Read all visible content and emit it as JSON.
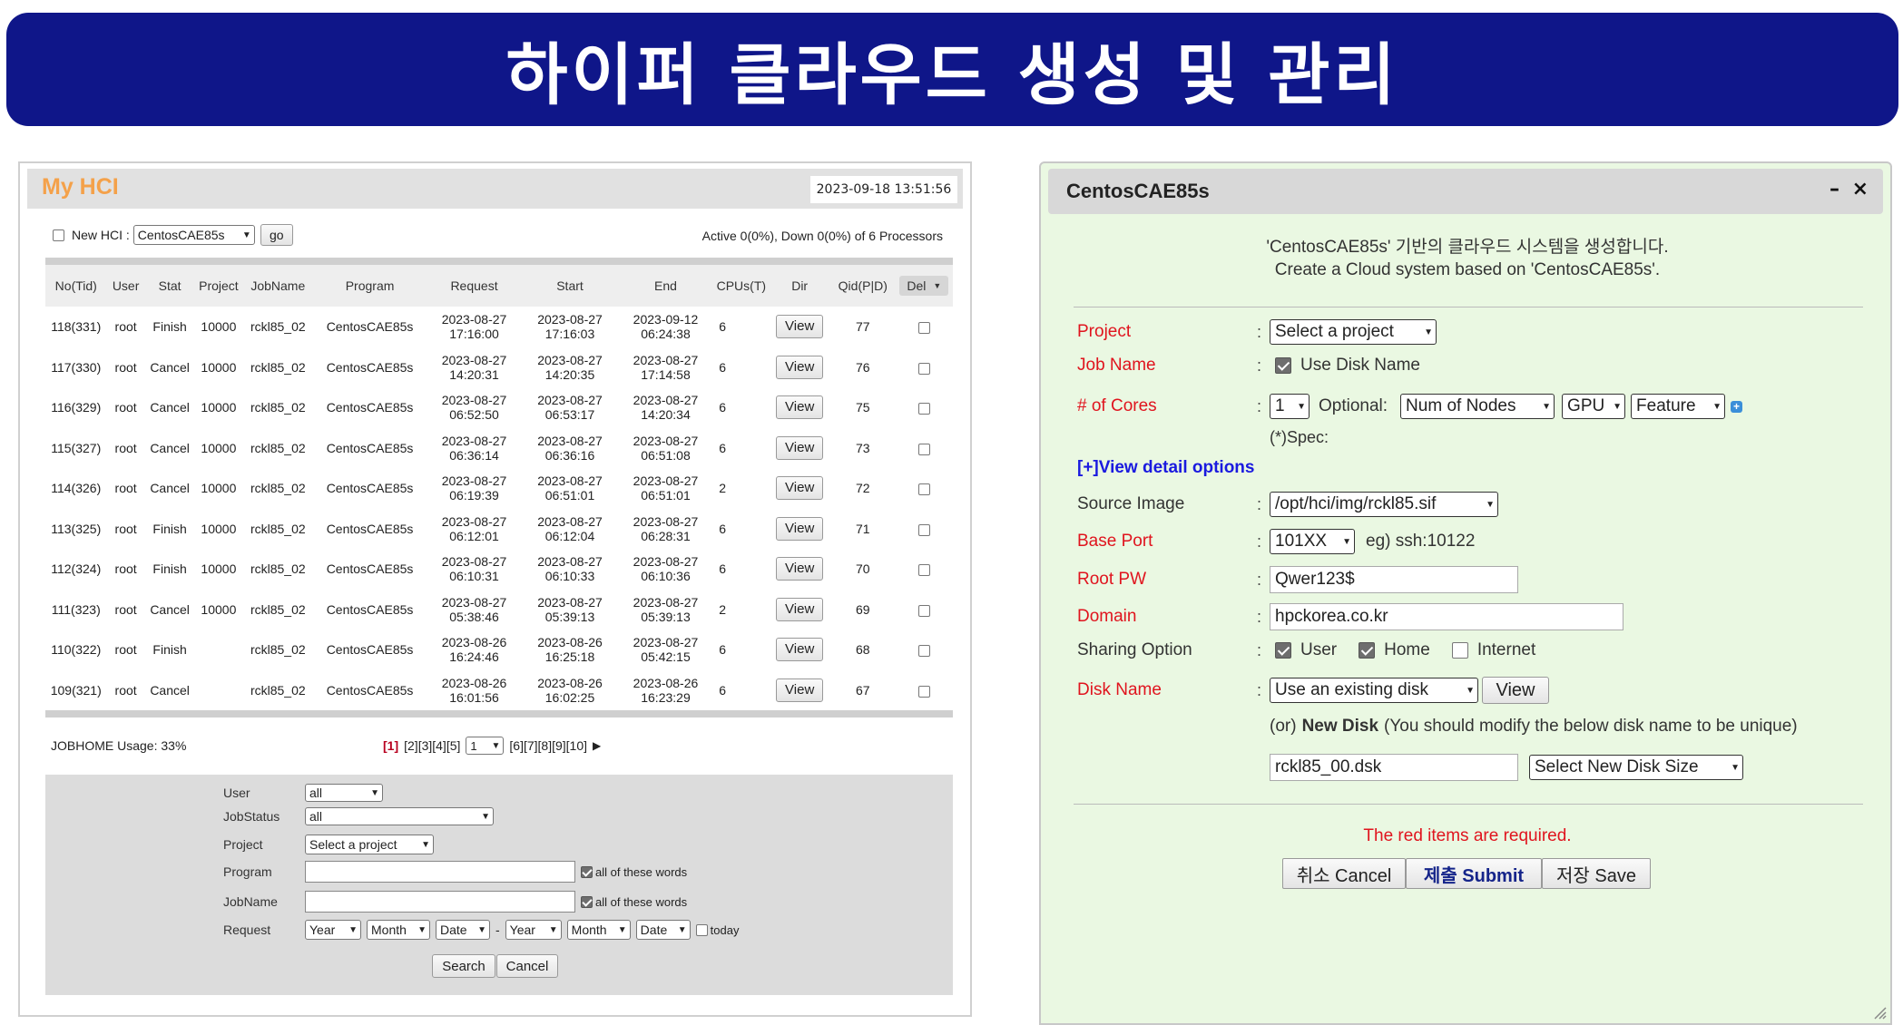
{
  "banner": {
    "title": "하이퍼 클라우드 생성 및 관리"
  },
  "my_hci": {
    "title": "My HCI",
    "datetime": "2023-09-18 13:51:56",
    "new_hci_label": "New HCI :",
    "new_hci_select": "CentosCAE85s",
    "go_label": "go",
    "processors_text": "Active 0(0%), Down 0(0%) of 6 Processors",
    "columns": [
      "No(Tid)",
      "User",
      "Stat",
      "Project",
      "JobName",
      "Program",
      "Request",
      "Start",
      "End",
      "CPUs(T)",
      "Dir",
      "Qid(P|D)",
      "Del"
    ],
    "view_label": "View",
    "rows": [
      {
        "no": "118(331)",
        "user": "root",
        "stat": "Finish",
        "project": "10000",
        "job": "rckl85_02",
        "program": "CentosCAE85s",
        "req_d": "2023-08-27",
        "req_t": "17:16:00",
        "start_d": "2023-08-27",
        "start_t": "17:16:03",
        "end_d": "2023-09-12",
        "end_t": "06:24:38",
        "cpus": "6",
        "qid": "77"
      },
      {
        "no": "117(330)",
        "user": "root",
        "stat": "Cancel",
        "project": "10000",
        "job": "rckl85_02",
        "program": "CentosCAE85s",
        "req_d": "2023-08-27",
        "req_t": "14:20:31",
        "start_d": "2023-08-27",
        "start_t": "14:20:35",
        "end_d": "2023-08-27",
        "end_t": "17:14:58",
        "cpus": "6",
        "qid": "76"
      },
      {
        "no": "116(329)",
        "user": "root",
        "stat": "Cancel",
        "project": "10000",
        "job": "rckl85_02",
        "program": "CentosCAE85s",
        "req_d": "2023-08-27",
        "req_t": "06:52:50",
        "start_d": "2023-08-27",
        "start_t": "06:53:17",
        "end_d": "2023-08-27",
        "end_t": "14:20:34",
        "cpus": "6",
        "qid": "75"
      },
      {
        "no": "115(327)",
        "user": "root",
        "stat": "Cancel",
        "project": "10000",
        "job": "rckl85_02",
        "program": "CentosCAE85s",
        "req_d": "2023-08-27",
        "req_t": "06:36:14",
        "start_d": "2023-08-27",
        "start_t": "06:36:16",
        "end_d": "2023-08-27",
        "end_t": "06:51:08",
        "cpus": "6",
        "qid": "73"
      },
      {
        "no": "114(326)",
        "user": "root",
        "stat": "Cancel",
        "project": "10000",
        "job": "rckl85_02",
        "program": "CentosCAE85s",
        "req_d": "2023-08-27",
        "req_t": "06:19:39",
        "start_d": "2023-08-27",
        "start_t": "06:51:01",
        "end_d": "2023-08-27",
        "end_t": "06:51:01",
        "cpus": "2",
        "qid": "72"
      },
      {
        "no": "113(325)",
        "user": "root",
        "stat": "Finish",
        "project": "10000",
        "job": "rckl85_02",
        "program": "CentosCAE85s",
        "req_d": "2023-08-27",
        "req_t": "06:12:01",
        "start_d": "2023-08-27",
        "start_t": "06:12:04",
        "end_d": "2023-08-27",
        "end_t": "06:28:31",
        "cpus": "6",
        "qid": "71"
      },
      {
        "no": "112(324)",
        "user": "root",
        "stat": "Finish",
        "project": "10000",
        "job": "rckl85_02",
        "program": "CentosCAE85s",
        "req_d": "2023-08-27",
        "req_t": "06:10:31",
        "start_d": "2023-08-27",
        "start_t": "06:10:33",
        "end_d": "2023-08-27",
        "end_t": "06:10:36",
        "cpus": "6",
        "qid": "70"
      },
      {
        "no": "111(323)",
        "user": "root",
        "stat": "Cancel",
        "project": "10000",
        "job": "rckl85_02",
        "program": "CentosCAE85s",
        "req_d": "2023-08-27",
        "req_t": "05:38:46",
        "start_d": "2023-08-27",
        "start_t": "05:39:13",
        "end_d": "2023-08-27",
        "end_t": "05:39:13",
        "cpus": "2",
        "qid": "69"
      },
      {
        "no": "110(322)",
        "user": "root",
        "stat": "Finish",
        "project": "",
        "job": "rckl85_02",
        "program": "CentosCAE85s",
        "req_d": "2023-08-26",
        "req_t": "16:24:46",
        "start_d": "2023-08-26",
        "start_t": "16:25:18",
        "end_d": "2023-08-27",
        "end_t": "05:42:15",
        "cpus": "6",
        "qid": "68"
      },
      {
        "no": "109(321)",
        "user": "root",
        "stat": "Cancel",
        "project": "",
        "job": "rckl85_02",
        "program": "CentosCAE85s",
        "req_d": "2023-08-26",
        "req_t": "16:01:56",
        "start_d": "2023-08-26",
        "start_t": "16:02:25",
        "end_d": "2023-08-26",
        "end_t": "16:23:29",
        "cpus": "6",
        "qid": "67"
      }
    ],
    "usage_text": "JOBHOME Usage: 33%",
    "pager": {
      "current": "[1]",
      "pages_a": "[2][3][4][5]",
      "select_value": "1",
      "pages_b": "[6][7][8][9][10]",
      "next": "▶"
    },
    "filter": {
      "user_label": "User",
      "user_value": "all",
      "jobstatus_label": "JobStatus",
      "jobstatus_value": "all",
      "project_label": "Project",
      "project_value": "Select a project",
      "program_label": "Program",
      "program_value": "",
      "jobname_label": "JobName",
      "jobname_value": "",
      "all_words": "all of these words",
      "request_label": "Request",
      "year": "Year",
      "month": "Month",
      "date": "Date",
      "dash": "-",
      "today": "today",
      "search": "Search",
      "cancel": "Cancel"
    }
  },
  "create_dialog": {
    "title": "CentosCAE85s",
    "minimize": "–",
    "close": "×",
    "intro_ko": "'CentosCAE85s' 기반의 클라우드 시스템을 생성합니다.",
    "intro_en": "Create a Cloud system based on 'CentosCAE85s'.",
    "project_label": "Project",
    "project_value": "Select a project",
    "jobname_label": "Job Name",
    "use_disk_name": "Use Disk Name",
    "cores_label": "# of Cores",
    "cores_value": "1",
    "optional": "Optional:",
    "num_nodes": "Num of Nodes",
    "gpu": "GPU",
    "feature": "Feature",
    "spec": "(*)Spec:",
    "view_detail": "[+]View detail options",
    "source_image_label": "Source Image",
    "source_image_value": "/opt/hci/img/rckl85.sif",
    "base_port_label": "Base Port",
    "base_port_value": "101XX",
    "base_port_eg": "eg) ssh:10122",
    "root_pw_label": "Root PW",
    "root_pw_value": "Qwer123$",
    "domain_label": "Domain",
    "domain_value": "hpckorea.co.kr",
    "sharing_label": "Sharing Option",
    "share_user": "User",
    "share_home": "Home",
    "share_internet": "Internet",
    "disk_name_label": "Disk Name",
    "disk_select": "Use an existing disk",
    "disk_view": "View",
    "new_disk_or": "(or)",
    "new_disk_bold": "New Disk",
    "new_disk_note": "(You should modify the below disk name to be unique)",
    "new_disk_value": "rckl85_00.dsk",
    "new_disk_size": "Select New Disk Size",
    "required_note": "The red items are required.",
    "btn_cancel": "취소 Cancel",
    "btn_submit": "제출 Submit",
    "btn_save": "저장 Save"
  }
}
